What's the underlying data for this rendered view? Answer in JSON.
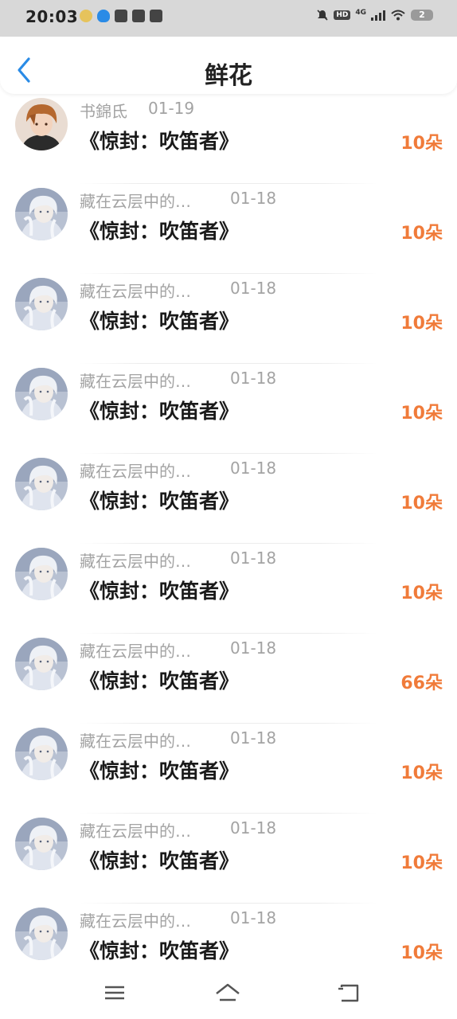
{
  "status_bar": {
    "time": "20:03",
    "network": "4G",
    "hd": "HD",
    "battery": "2"
  },
  "header": {
    "title": "鲜花"
  },
  "gifts": [
    {
      "user": "书錦氐",
      "date": "01-19",
      "book": "《惊封：吹笛者》",
      "count": "10朵",
      "avatar": "avatar-brown-hair"
    },
    {
      "user": "藏在云层中的…",
      "date": "01-18",
      "book": "《惊封：吹笛者》",
      "count": "10朵",
      "avatar": "avatar-white-hair"
    },
    {
      "user": "藏在云层中的…",
      "date": "01-18",
      "book": "《惊封：吹笛者》",
      "count": "10朵",
      "avatar": "avatar-white-hair"
    },
    {
      "user": "藏在云层中的…",
      "date": "01-18",
      "book": "《惊封：吹笛者》",
      "count": "10朵",
      "avatar": "avatar-white-hair"
    },
    {
      "user": "藏在云层中的…",
      "date": "01-18",
      "book": "《惊封：吹笛者》",
      "count": "10朵",
      "avatar": "avatar-white-hair"
    },
    {
      "user": "藏在云层中的…",
      "date": "01-18",
      "book": "《惊封：吹笛者》",
      "count": "10朵",
      "avatar": "avatar-white-hair"
    },
    {
      "user": "藏在云层中的…",
      "date": "01-18",
      "book": "《惊封：吹笛者》",
      "count": "66朵",
      "avatar": "avatar-white-hair"
    },
    {
      "user": "藏在云层中的…",
      "date": "01-18",
      "book": "《惊封：吹笛者》",
      "count": "10朵",
      "avatar": "avatar-white-hair"
    },
    {
      "user": "藏在云层中的…",
      "date": "01-18",
      "book": "《惊封：吹笛者》",
      "count": "10朵",
      "avatar": "avatar-white-hair"
    },
    {
      "user": "藏在云层中的…",
      "date": "01-18",
      "book": "《惊封：吹笛者》",
      "count": "10朵",
      "avatar": "avatar-white-hair"
    }
  ],
  "colors": {
    "accent_count": "#f07b3a",
    "back_arrow": "#2a8be6"
  },
  "nav": {
    "menu_icon": "menu-icon",
    "home_icon": "home-icon",
    "back_icon": "back-icon"
  }
}
